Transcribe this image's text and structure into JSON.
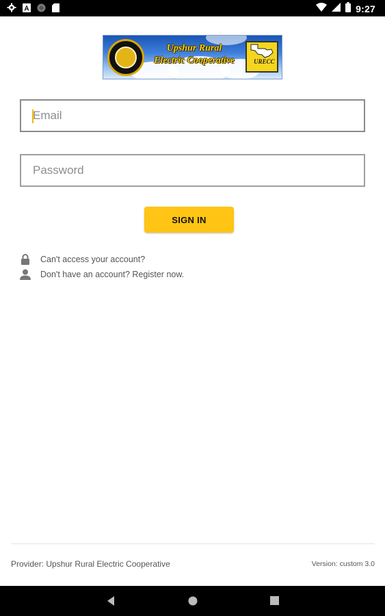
{
  "status_bar": {
    "time": "9:27",
    "left_icons": [
      "settings-icon",
      "notification-a-icon",
      "circle-icon",
      "sd-card-icon"
    ],
    "right_icons": [
      "wifi-icon",
      "signal-icon",
      "battery-icon"
    ]
  },
  "logo": {
    "line1": "Upshur Rural",
    "line2": "Electric Cooperative",
    "badge": "URECC"
  },
  "login": {
    "email_placeholder": "Email",
    "password_placeholder": "Password",
    "sign_in_label": "SIGN IN"
  },
  "links": {
    "cant_access": "Can't access your account?",
    "register": "Don't have an account? Register now."
  },
  "footer": {
    "provider": "Provider: Upshur Rural Electric Cooperative",
    "version": "Version: custom 3.0"
  },
  "colors": {
    "accent": "#ffc414",
    "caret": "#f5b800",
    "status_bar": "#000000"
  }
}
